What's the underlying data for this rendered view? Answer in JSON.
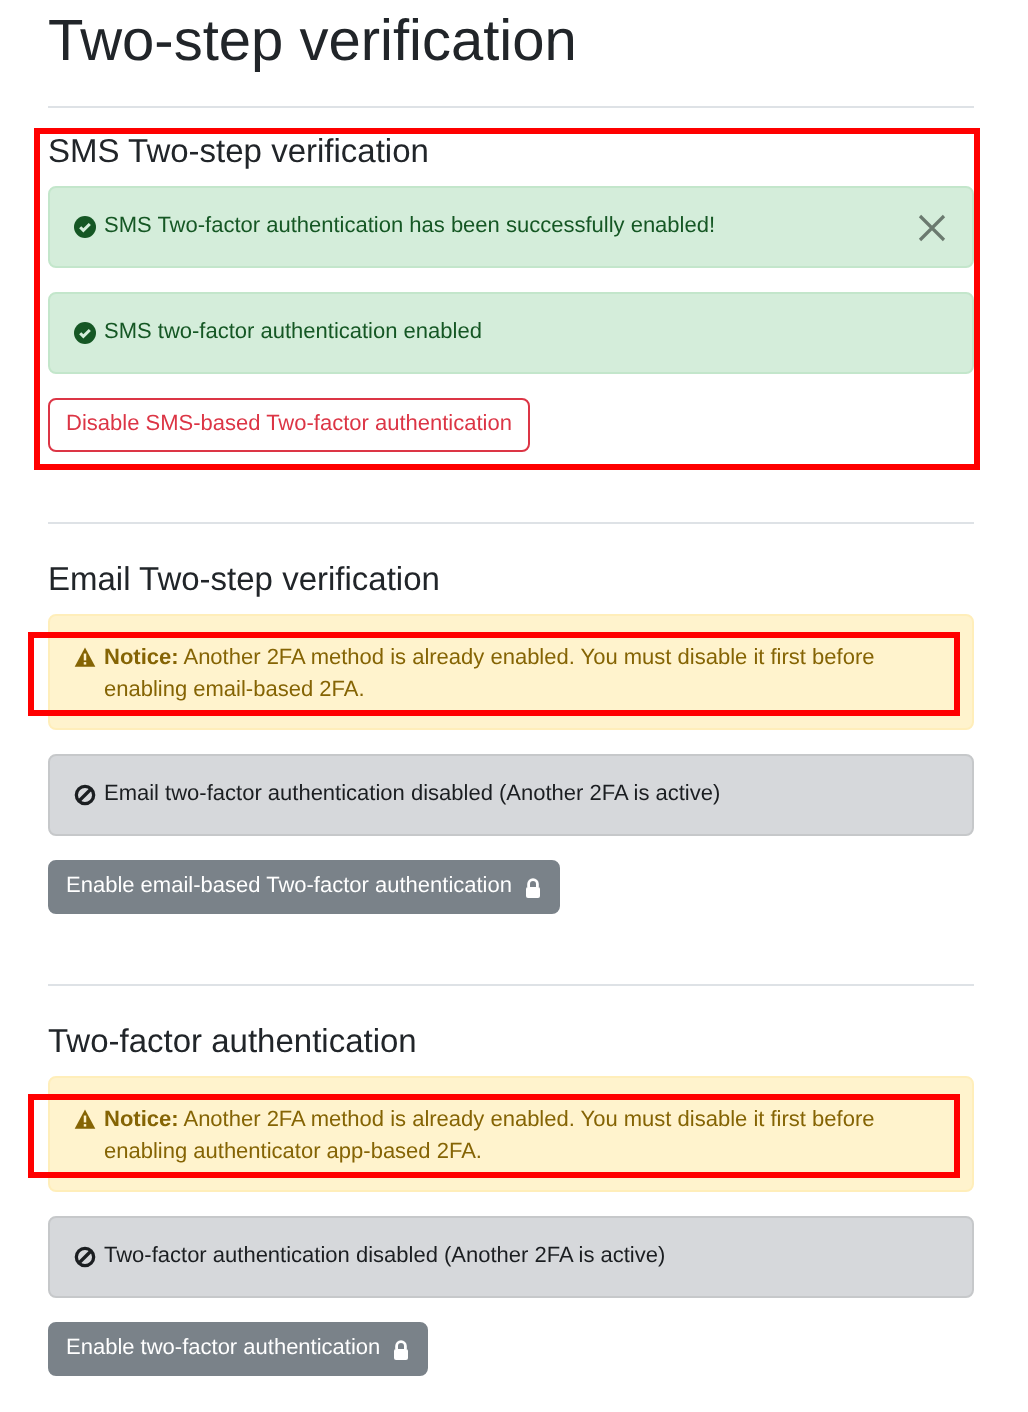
{
  "page_title": "Two-step verification",
  "sections": [
    {
      "heading": "SMS Two-step verification",
      "highlighted": true,
      "alerts": [
        {
          "kind": "success",
          "text": "SMS Two-factor authentication has been successfully enabled!",
          "dismissible": true,
          "highlighted": false
        },
        {
          "kind": "success",
          "text": "SMS two-factor authentication enabled",
          "dismissible": false,
          "highlighted": false
        }
      ],
      "button": {
        "kind": "outline-danger",
        "label": "Disable SMS-based Two-factor authentication",
        "locked": false
      }
    },
    {
      "heading": "Email Two-step verification",
      "highlighted": false,
      "alerts": [
        {
          "kind": "notice",
          "text": "**Notice:** Another 2FA method is already enabled. You must disable it first before enabling email-based 2FA.",
          "dismissible": false,
          "highlighted": true
        },
        {
          "kind": "disabled",
          "text": "Email two-factor authentication disabled (Another 2FA is active)",
          "dismissible": false,
          "highlighted": false
        }
      ],
      "button": {
        "kind": "secondary",
        "label": "Enable email-based Two-factor authentication",
        "locked": true
      }
    },
    {
      "heading": "Two-factor authentication",
      "highlighted": false,
      "alerts": [
        {
          "kind": "notice",
          "text": "**Notice:** Another 2FA method is already enabled. You must disable it first before enabling authenticator app-based 2FA.",
          "dismissible": false,
          "highlighted": true
        },
        {
          "kind": "disabled",
          "text": "Two-factor authentication disabled (Another 2FA is active)",
          "dismissible": false,
          "highlighted": false
        }
      ],
      "button": {
        "kind": "secondary",
        "label": "Enable two-factor authentication",
        "locked": true
      }
    }
  ]
}
